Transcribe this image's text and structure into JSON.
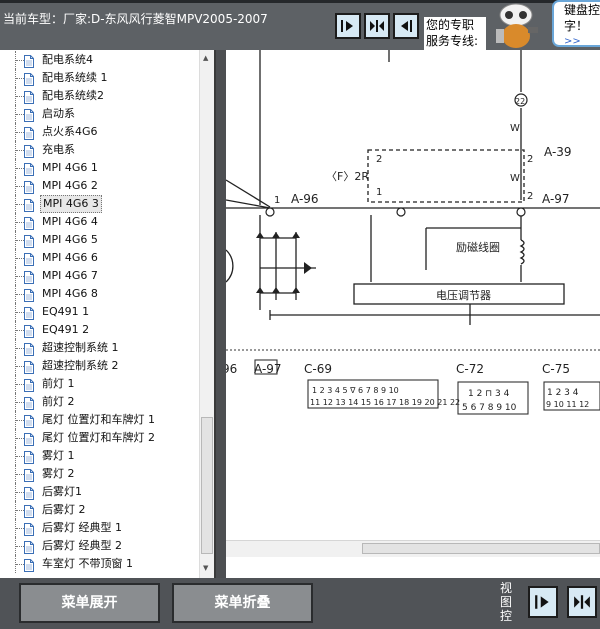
{
  "header": {
    "model_label": "当前车型：厂家:D-东风风行菱智MPV2005-2007",
    "hotline_line1": "您的专职",
    "hotline_line2": "服务专线:",
    "tip_line1": "键盘控",
    "tip_line2": "字！",
    "tip_more": ">>"
  },
  "toolbar": {
    "icons": [
      "arrow-right-icon",
      "expand-horizontal-icon",
      "arrow-left-icon"
    ]
  },
  "tree": {
    "selected_index": 10,
    "items": [
      "配电系统4",
      "配电系统续 1",
      "配电系统续2",
      "启动系",
      "点火系4G6",
      "充电系",
      "MPI 4G6 1",
      "MPI 4G6 2",
      "MPI 4G6 3",
      "MPI 4G6 4",
      "MPI 4G6 5",
      "MPI 4G6 6",
      "MPI 4G6 7",
      "MPI 4G6 8",
      "EQ491 1",
      "EQ491 2",
      "超速控制系统 1",
      "超速控制系统 2",
      "前灯 1",
      "前灯 2",
      "尾灯 位置灯和车牌灯 1",
      "尾灯 位置灯和车牌灯 2",
      "雾灯 1",
      "雾灯 2",
      "后雾灯1",
      "后雾灯 2",
      "后雾灯 经典型 1",
      "后雾灯 经典型 2",
      "车室灯 不带顶窗 1"
    ]
  },
  "diagram": {
    "labels": {
      "a96": "A-96",
      "a97": "A-97",
      "a39": "A-39",
      "c69": "C-69",
      "c72": "C-72",
      "c75": "C-75",
      "a97b": "A-97",
      "frag96": "96",
      "f2r": "〈F〉2R",
      "excitation_coil": "励磁线圈",
      "voltage_regulator": "电压调节器",
      "w1": "W",
      "w2": "W",
      "n22": "22",
      "n1a": "1",
      "n2a": "2",
      "n1b": "1",
      "n2b": "2",
      "n1c": "1",
      "n1d": "1",
      "n2c": "2",
      "c69_row1": "1 2 3 4 5 ∇ 6 7 8 9 10",
      "c69_row2": "11 12 13 14 15 16 17 18 19 20 21 22",
      "c72_row1": "1 2 ⊓ 3 4",
      "c72_row2": "5 6 7 8 9 10",
      "c75_row1": "1 2 3 4",
      "c75_row2": "9 10 11 12"
    }
  },
  "bottom": {
    "expand_label": "菜单展开",
    "collapse_label": "菜单折叠",
    "view_control": "视图控"
  }
}
